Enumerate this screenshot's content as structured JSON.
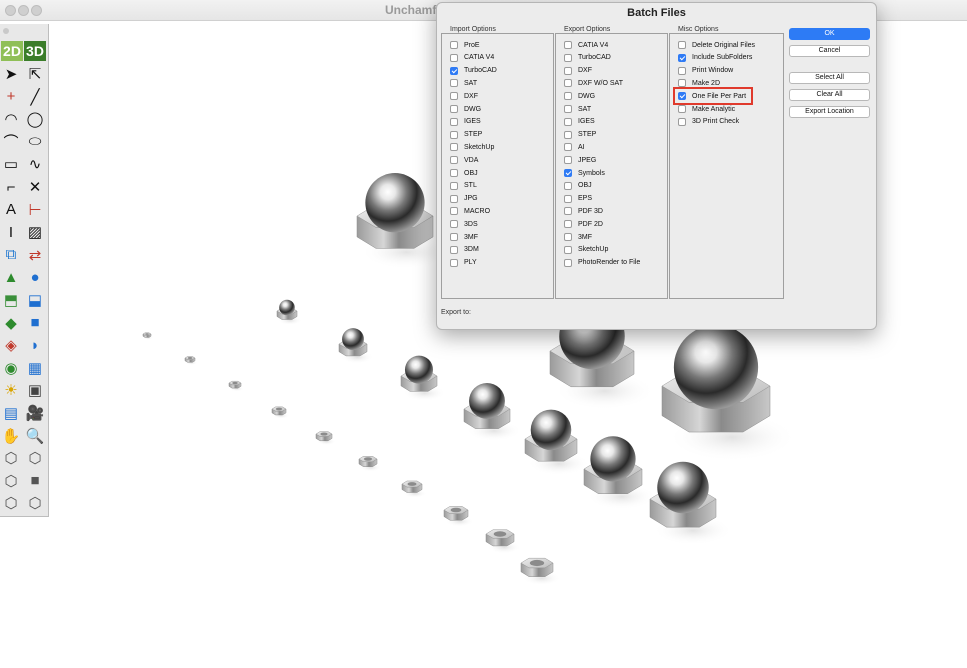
{
  "window": {
    "title": "Unchamfere"
  },
  "toolbar": {
    "mode_2d": "2D",
    "mode_3d": "3D",
    "tools": [
      {
        "icon": "arrow-select-icon"
      },
      {
        "icon": "arrow-outline-select-icon"
      },
      {
        "icon": "point-icon"
      },
      {
        "icon": "line-icon"
      },
      {
        "icon": "arc-icon"
      },
      {
        "icon": "circle-icon"
      },
      {
        "icon": "curve-icon"
      },
      {
        "icon": "ellipse-icon"
      },
      {
        "icon": "rectangle-icon"
      },
      {
        "icon": "spline-icon"
      },
      {
        "icon": "fillet-icon"
      },
      {
        "icon": "trim-icon"
      },
      {
        "icon": "text-icon"
      },
      {
        "icon": "dimension-icon"
      },
      {
        "icon": "cursor-bar-icon"
      },
      {
        "icon": "hatch-icon"
      },
      {
        "icon": "transform-icon"
      },
      {
        "icon": "mirror-icon"
      },
      {
        "icon": "cone-icon"
      },
      {
        "icon": "sphere-icon"
      },
      {
        "icon": "extrude-icon"
      },
      {
        "icon": "boolean-icon"
      },
      {
        "icon": "loft-icon"
      },
      {
        "icon": "cube-icon"
      },
      {
        "icon": "shell-icon"
      },
      {
        "icon": "fillet-3d-icon"
      },
      {
        "icon": "render-icon"
      },
      {
        "icon": "assembly-icon"
      },
      {
        "icon": "light-icon"
      },
      {
        "icon": "grid-icon"
      },
      {
        "icon": "film-icon"
      },
      {
        "icon": "camera-icon"
      },
      {
        "icon": "pan-hand-icon"
      },
      {
        "icon": "zoom-icon"
      },
      {
        "icon": "iso-view-icon"
      },
      {
        "icon": "front-view-icon"
      },
      {
        "icon": "side-view-icon"
      },
      {
        "icon": "shaded-cube-icon"
      },
      {
        "icon": "wire-cube-icon"
      },
      {
        "icon": "hidden-cube-icon"
      }
    ]
  },
  "dialog": {
    "title": "Batch Files",
    "import": {
      "title": "Import Options",
      "items": [
        {
          "label": "ProE",
          "checked": false
        },
        {
          "label": "CATIA V4",
          "checked": false
        },
        {
          "label": "TurboCAD",
          "checked": true
        },
        {
          "label": "SAT",
          "checked": false
        },
        {
          "label": "DXF",
          "checked": false
        },
        {
          "label": "DWG",
          "checked": false
        },
        {
          "label": "IGES",
          "checked": false
        },
        {
          "label": "STEP",
          "checked": false
        },
        {
          "label": "SketchUp",
          "checked": false
        },
        {
          "label": "VDA",
          "checked": false
        },
        {
          "label": "OBJ",
          "checked": false
        },
        {
          "label": "STL",
          "checked": false
        },
        {
          "label": "JPG",
          "checked": false
        },
        {
          "label": "MACRO",
          "checked": false
        },
        {
          "label": "3DS",
          "checked": false
        },
        {
          "label": "3MF",
          "checked": false
        },
        {
          "label": "3DM",
          "checked": false
        },
        {
          "label": "PLY",
          "checked": false
        }
      ]
    },
    "export": {
      "title": "Export Options",
      "items": [
        {
          "label": "CATIA V4",
          "checked": false
        },
        {
          "label": "TurboCAD",
          "checked": false
        },
        {
          "label": "DXF",
          "checked": false
        },
        {
          "label": "DXF W/O SAT",
          "checked": false
        },
        {
          "label": "DWG",
          "checked": false
        },
        {
          "label": "SAT",
          "checked": false
        },
        {
          "label": "IGES",
          "checked": false
        },
        {
          "label": "STEP",
          "checked": false
        },
        {
          "label": "AI",
          "checked": false
        },
        {
          "label": "JPEG",
          "checked": false
        },
        {
          "label": "Symbols",
          "checked": true
        },
        {
          "label": "OBJ",
          "checked": false
        },
        {
          "label": "EPS",
          "checked": false
        },
        {
          "label": "PDF 3D",
          "checked": false
        },
        {
          "label": "PDF 2D",
          "checked": false
        },
        {
          "label": "3MF",
          "checked": false
        },
        {
          "label": "SketchUp",
          "checked": false
        },
        {
          "label": "PhotoRender to File",
          "checked": false
        }
      ]
    },
    "misc": {
      "title": "Misc Options",
      "items": [
        {
          "label": "Delete Original Files",
          "checked": false
        },
        {
          "label": "Include SubFolders",
          "checked": true
        },
        {
          "label": "Print Window",
          "checked": false
        },
        {
          "label": "Make 2D",
          "checked": false
        },
        {
          "label": "One File Per Part",
          "checked": true
        },
        {
          "label": "Make Analytic",
          "checked": false
        },
        {
          "label": "3D Print Check",
          "checked": false
        }
      ]
    },
    "buttons": {
      "ok": "OK",
      "cancel": "Cancel",
      "select_all": "Select All",
      "clear_all": "Clear All",
      "export_location": "Export Location"
    },
    "export_to_label": "Export to:"
  },
  "colors": {
    "accent": "#2d7bf5",
    "highlight": "#e03a2c",
    "mode_2d": "#8fbf57",
    "mode_3d": "#3b7d2a"
  }
}
